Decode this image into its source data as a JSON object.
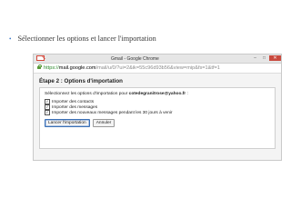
{
  "slide": {
    "bullet": "•",
    "text": "Sélectionner les options et lancer l'importation"
  },
  "window": {
    "title": "Gmail - Google Chrome",
    "minimize": "–",
    "maximize": "□",
    "close": "✕"
  },
  "address": {
    "scheme": "https://",
    "host": "mail.google.com",
    "path": "/mail/u/0/?ui=2&ik=55c96d93b56&view=mip&fs=1&tf=1"
  },
  "dialog": {
    "title": "Étape 2 : Options d'importation",
    "intro_prefix": "Sélectionnez les options d'importation pour ",
    "email": "cotedegranitrose@yahoo.fr",
    "intro_suffix": " :",
    "options": [
      {
        "label": "Importer des contacts",
        "checked": true
      },
      {
        "label": "Importer des messages",
        "checked": true
      },
      {
        "label": "Importer des nouveaux messages pendant les 30 jours à venir",
        "checked": true
      }
    ],
    "start_button": "Lancer l'importation",
    "cancel_button": "Annuler"
  },
  "colors": {
    "bullet": "#3b78c7",
    "url_scheme": "#2e8b2e",
    "gmail_red": "#d44638"
  }
}
